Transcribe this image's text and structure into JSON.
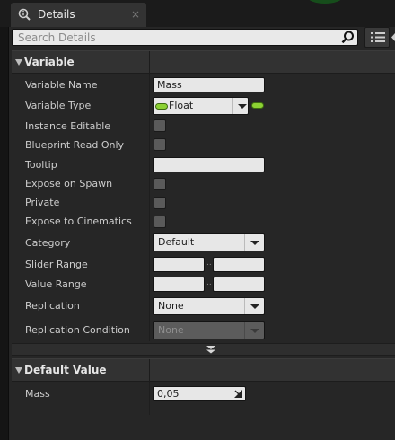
{
  "tab": {
    "title": "Details",
    "close": "×"
  },
  "search": {
    "placeholder": "Search Details"
  },
  "variable_section": {
    "title": "Variable"
  },
  "fields": {
    "variable_name": {
      "label": "Variable Name",
      "value": "Mass"
    },
    "variable_type": {
      "label": "Variable Type",
      "value": "Float",
      "pin_color": "#8cd133"
    },
    "instance_editable": {
      "label": "Instance Editable",
      "checked": false
    },
    "blueprint_read_only": {
      "label": "Blueprint Read Only",
      "checked": false
    },
    "tooltip": {
      "label": "Tooltip",
      "value": ""
    },
    "expose_on_spawn": {
      "label": "Expose on Spawn",
      "checked": false
    },
    "private": {
      "label": "Private",
      "checked": false
    },
    "expose_to_cinematics": {
      "label": "Expose to Cinematics",
      "checked": false
    },
    "category": {
      "label": "Category",
      "value": "Default"
    },
    "slider_range": {
      "label": "Slider Range",
      "min": "",
      "max": ""
    },
    "value_range": {
      "label": "Value Range",
      "min": "",
      "max": ""
    },
    "replication": {
      "label": "Replication",
      "value": "None"
    },
    "replication_condition": {
      "label": "Replication Condition",
      "value": "None",
      "enabled": false
    }
  },
  "default_section": {
    "title": "Default Value"
  },
  "default_fields": {
    "mass": {
      "label": "Mass",
      "value": "0,05"
    }
  },
  "icons": [
    "details-tab-icon",
    "search-icon",
    "view-options-icon",
    "collapse-triangle-icon",
    "expand-advanced-icon",
    "drag-grip-icon"
  ]
}
